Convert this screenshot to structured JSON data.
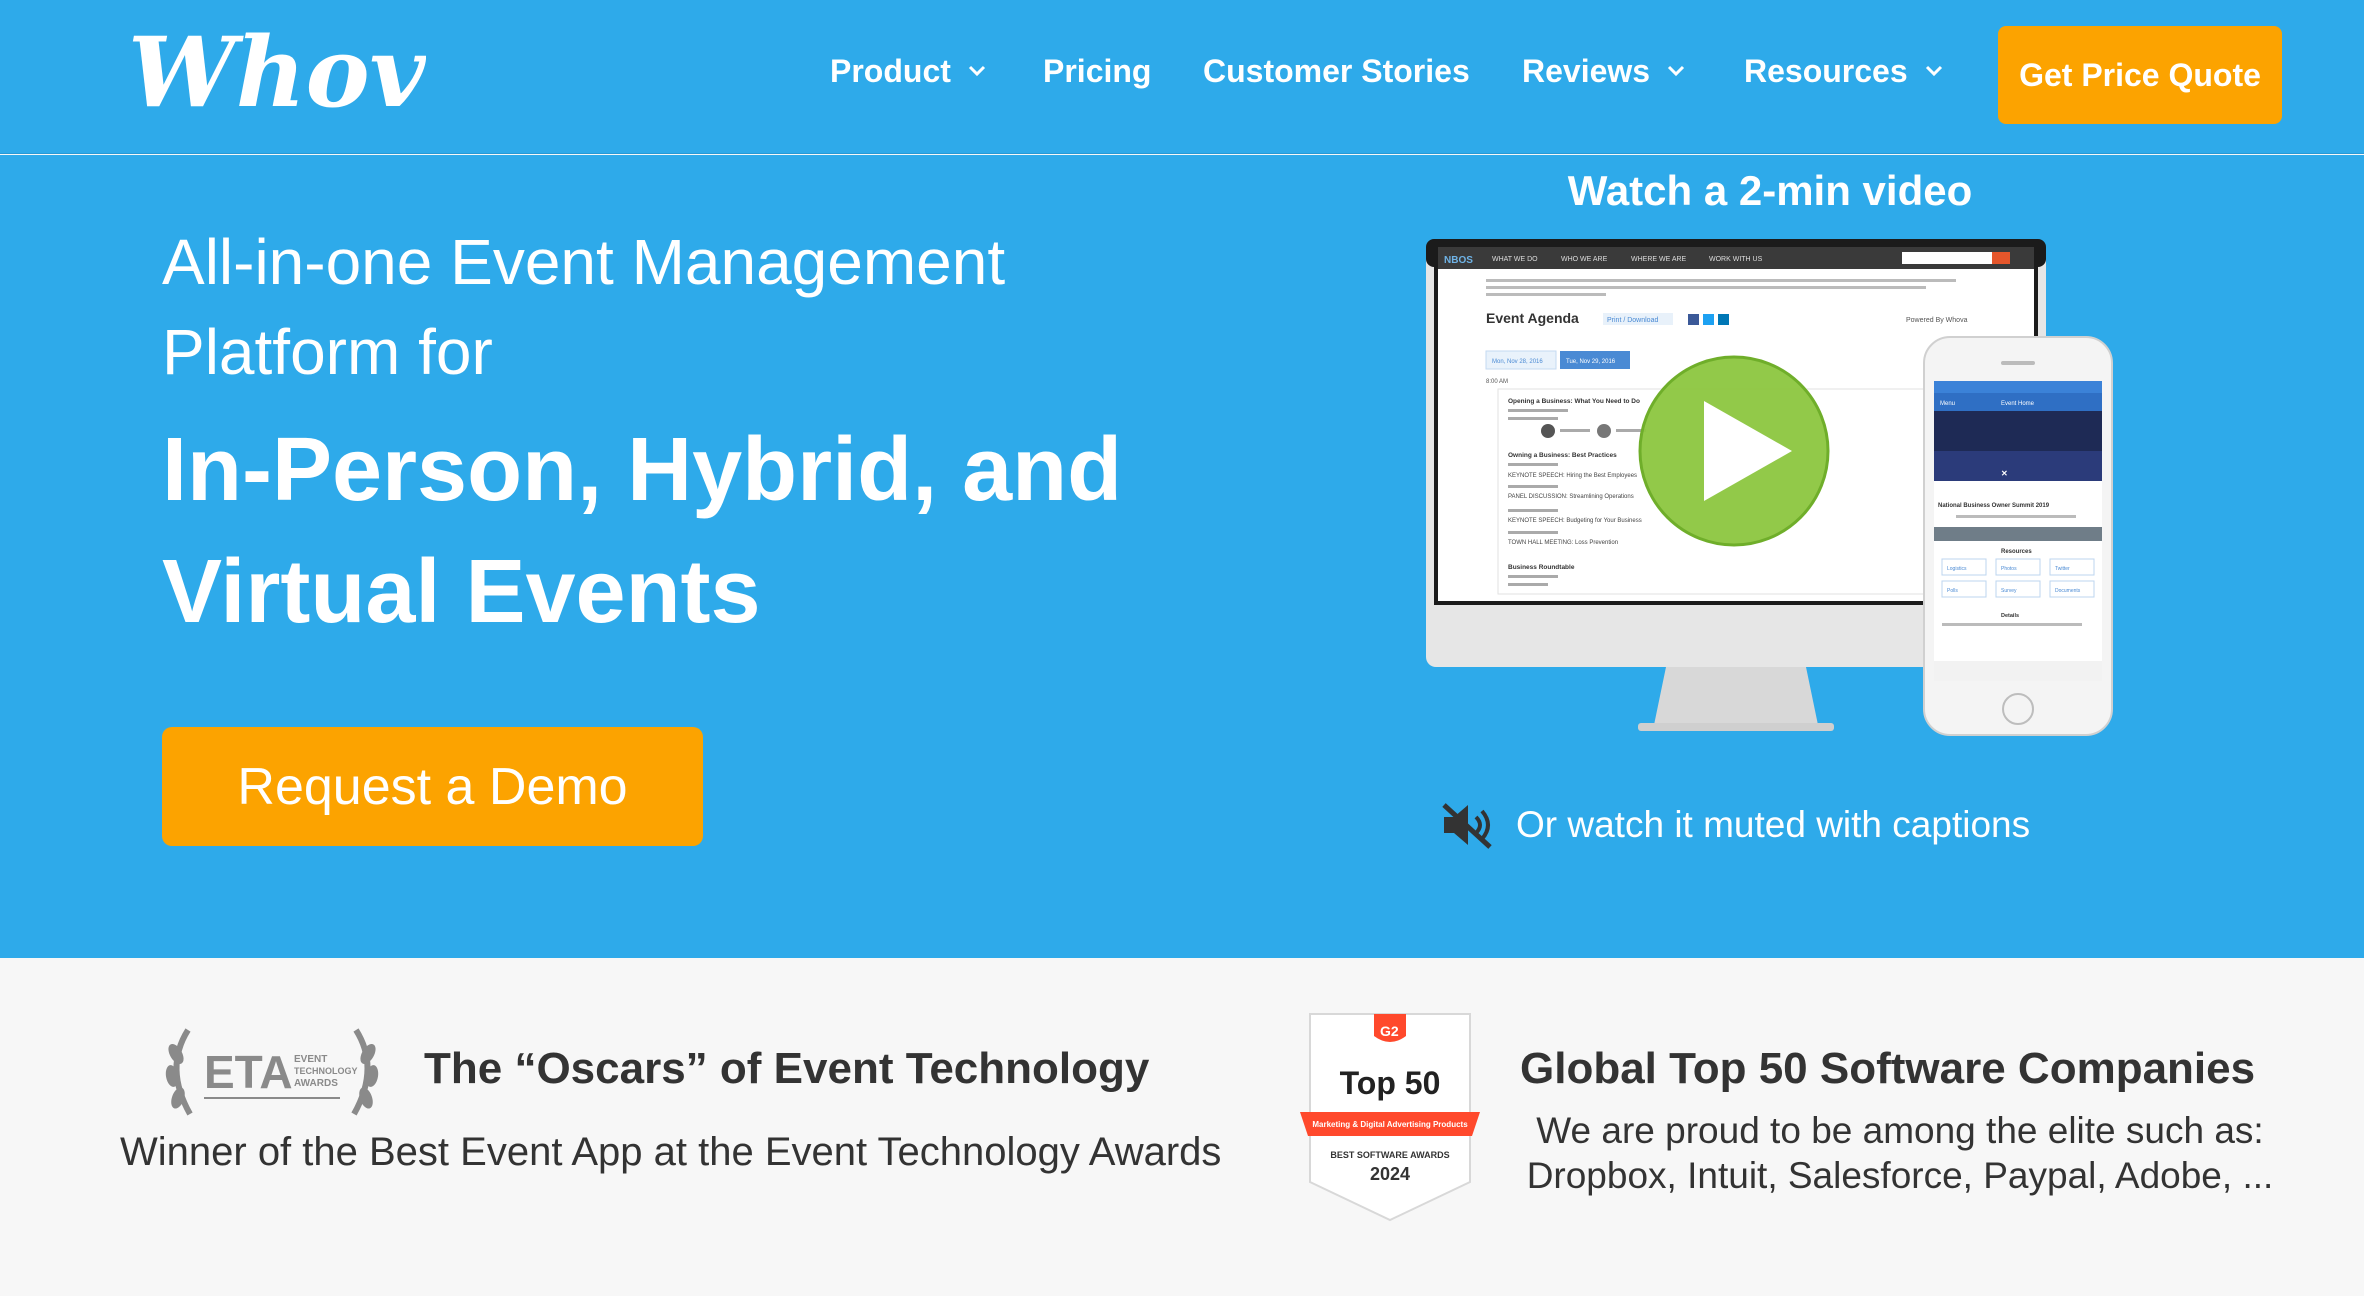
{
  "header": {
    "logo_text": "Whova",
    "nav": [
      {
        "label": "Product",
        "has_dropdown": true
      },
      {
        "label": "Pricing",
        "has_dropdown": false
      },
      {
        "label": "Customer Stories",
        "has_dropdown": false
      },
      {
        "label": "Reviews",
        "has_dropdown": true
      },
      {
        "label": "Resources",
        "has_dropdown": true
      }
    ],
    "cta_label": "Get Price Quote"
  },
  "hero": {
    "subtitle_line1": "All-in-one Event Management",
    "subtitle_line2": "Platform for",
    "title_line1": "In-Person, Hybrid, and",
    "title_line2": "Virtual Events",
    "demo_label": "Request a Demo",
    "video_title": "Watch a 2-min video",
    "muted_label": "Or watch it muted with captions"
  },
  "mockup": {
    "menu": [
      "WHAT WE DO",
      "WHO WE ARE",
      "WHERE WE ARE",
      "WORK WITH US"
    ],
    "brand": "NBOS",
    "agenda_title": "Event Agenda",
    "print_label": "Print / Download",
    "powered_by": "Powered By Whova",
    "dates": [
      "Mon, Nov 28, 2016",
      "Tue, Nov 29, 2016"
    ],
    "time": "8:00 AM",
    "sessions": [
      "Opening a Business: What You Need to Do",
      "Owning a Business: Best Practices",
      "KEYNOTE SPEECH: Hiring the Best Employees",
      "PANEL DISCUSSION: Streamlining Operations",
      "KEYNOTE SPEECH: Budgeting for Your Business",
      "TOWN HALL MEETING: Loss Prevention",
      "Business Roundtable"
    ],
    "phone_header": "Event Home",
    "phone_menu": "Menu",
    "phone_event": "National Business Owner Summit 2019",
    "phone_resources": "Resources",
    "phone_details": "Details",
    "phone_buttons": [
      "Logistics",
      "Photos",
      "Twitter",
      "Polls",
      "Survey",
      "Documents"
    ]
  },
  "awards": {
    "eta_logo_text": "ETA",
    "eta_logo_small": [
      "EVENT",
      "TECHNOLOGY",
      "AWARDS"
    ],
    "oscars_title": "The “Oscars” of Event Technology",
    "oscars_sub": "Winner of the Best Event App at the Event Technology Awards",
    "g2_badge": {
      "logo": "G2",
      "rank": "Top 50",
      "ribbon": "Marketing & Digital Advertising Products",
      "line1": "BEST SOFTWARE AWARDS",
      "year": "2024"
    },
    "top50_title": "Global Top 50 Software Companies",
    "top50_sub_line1": "We are proud to be among the elite such as:",
    "top50_sub_line2": "Dropbox, Intuit, Salesforce, Paypal, Adobe, ..."
  },
  "colors": {
    "brand_blue": "#2eaaea",
    "accent_orange": "#fca300",
    "play_green": "#8cc63f",
    "g2_red": "#ff492c"
  }
}
